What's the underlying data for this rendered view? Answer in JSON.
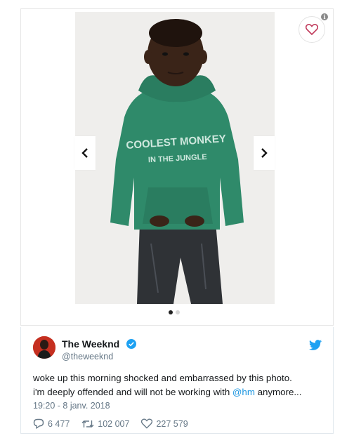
{
  "product": {
    "hoodie_print_line1": "COOLEST MONKEY",
    "hoodie_print_line2": "IN THE JUNGLE",
    "prev_icon": "chevron-left-icon",
    "next_icon": "chevron-right-icon",
    "favorite_icon": "heart-icon",
    "info_icon": "info-icon",
    "info_glyph": "i",
    "carousel": {
      "total": 2,
      "active": 1
    }
  },
  "tweet": {
    "display_name": "The Weeknd",
    "handle": "@theweeknd",
    "text_line1": "woke up this morning shocked and embarrassed by this photo.",
    "text_line2_before": "i'm deeply offended and will not be working with ",
    "mention": "@hm",
    "text_line2_after": " anymore...",
    "timestamp": "19:20 - 8 janv. 2018",
    "replies": "6 477",
    "retweets": "102 007",
    "likes": "227 579"
  },
  "colors": {
    "twitter_blue": "#1b95e0",
    "hoodie_green": "#2f8a6a",
    "heart_red": "#c0395a"
  }
}
